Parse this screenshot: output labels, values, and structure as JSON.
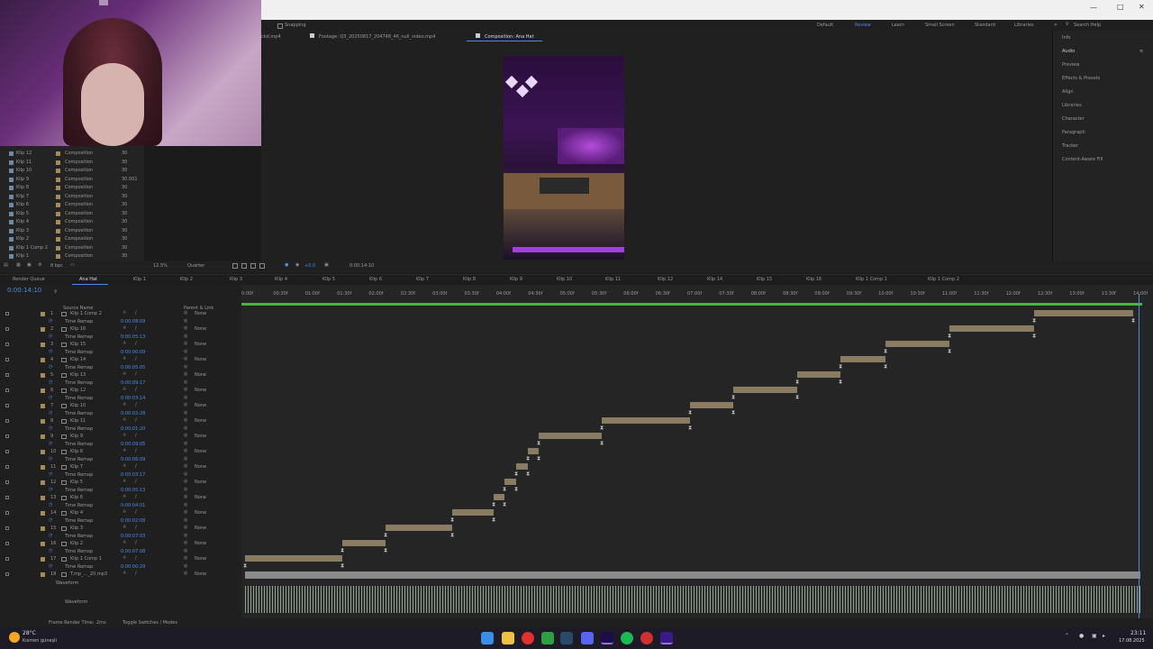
{
  "webcam": {
    "label": "webcam-overlay"
  },
  "header": {
    "snapping": "Snapping",
    "workspaces": [
      "Default",
      "Review",
      "Learn",
      "Small Screen",
      "Standard",
      "Libraries"
    ],
    "search_placeholder": "Search Help"
  },
  "viewer_tabs": {
    "tab1": "ckd.mp4",
    "tab2": "Footage: Q3_20250817_204748_46_null_video.mp4",
    "tab3": "Composition: Ana Hat"
  },
  "right_panel": {
    "items": [
      "Info",
      "Audio",
      "Preview",
      "Effects & Presets",
      "Align",
      "Libraries",
      "Character",
      "Paragraph",
      "Tracker",
      "Content-Aware Fill"
    ]
  },
  "project": {
    "rows": [
      {
        "name": "Klip 12",
        "type": "Composition",
        "fps": "30"
      },
      {
        "name": "Klip 11",
        "type": "Composition",
        "fps": "30"
      },
      {
        "name": "Klip 10",
        "type": "Composition",
        "fps": "30"
      },
      {
        "name": "Klip 9",
        "type": "Composition",
        "fps": "30.001"
      },
      {
        "name": "Klip 8",
        "type": "Composition",
        "fps": "30"
      },
      {
        "name": "Klip 7",
        "type": "Composition",
        "fps": "30"
      },
      {
        "name": "Klip 6",
        "type": "Composition",
        "fps": "30"
      },
      {
        "name": "Klip 5",
        "type": "Composition",
        "fps": "30"
      },
      {
        "name": "Klip 4",
        "type": "Composition",
        "fps": "30"
      },
      {
        "name": "Klip 3",
        "type": "Composition",
        "fps": "30"
      },
      {
        "name": "Klip 2",
        "type": "Composition",
        "fps": "30"
      },
      {
        "name": "Klip 1 Comp 2",
        "type": "Composition",
        "fps": "30"
      },
      {
        "name": "Klip 1",
        "type": "Composition",
        "fps": "30"
      }
    ],
    "bpc": "8 bpc"
  },
  "viewer_controls": {
    "zoom": "12.5%",
    "resolution": "Quarter",
    "timecode": "0:00:14:10",
    "plus": "+0.0"
  },
  "timeline_tabs": [
    "Render Queue",
    "Ana Hat",
    "Klip 1",
    "Klip 2",
    "Klip 3",
    "Klip 4",
    "Klip 5",
    "Klip 6",
    "Klip 7",
    "Klip 8",
    "Klip 9",
    "Klip 10",
    "Klip 11",
    "Klip 12",
    "Klip 14",
    "Klip 15",
    "Klip 16",
    "Klip 1 Comp 1",
    "Klip 1 Comp 2"
  ],
  "timeline": {
    "current_time": "0:00:14:10",
    "col_source": "Source Name",
    "col_parent": "Parent & Link",
    "ruler": [
      "0:00f",
      "00:30f",
      "01:00f",
      "01:30f",
      "02:00f",
      "02:30f",
      "03:00f",
      "03:30f",
      "04:00f",
      "04:30f",
      "05:00f",
      "05:30f",
      "06:00f",
      "06:30f",
      "07:00f",
      "07:30f",
      "08:00f",
      "08:30f",
      "09:00f",
      "09:30f",
      "10:00f",
      "10:30f",
      "11:00f",
      "11:30f",
      "12:00f",
      "12:30f",
      "13:00f",
      "13:30f",
      "14:00f"
    ],
    "layers": [
      {
        "num": "1",
        "name": "Klip 1 Comp 2",
        "remap": "0:00:08:09",
        "parent": "None"
      },
      {
        "num": "2",
        "name": "Klip 16",
        "remap": "0:00:05:13",
        "parent": "None"
      },
      {
        "num": "3",
        "name": "Klip 15",
        "remap": "0:00:00:09",
        "parent": "None"
      },
      {
        "num": "4",
        "name": "Klip 14",
        "remap": "0:00:05:05",
        "parent": "None"
      },
      {
        "num": "5",
        "name": "Klip 13",
        "remap": "0:00:09:17",
        "parent": "None"
      },
      {
        "num": "6",
        "name": "Klip 12",
        "remap": "0:00:03:14",
        "parent": "None"
      },
      {
        "num": "7",
        "name": "Klip 10",
        "remap": "0:00:03:28",
        "parent": "None"
      },
      {
        "num": "8",
        "name": "Klip 11",
        "remap": "0:00:01:20",
        "parent": "None"
      },
      {
        "num": "9",
        "name": "Klip 9",
        "remap": "0:00:09:05",
        "parent": "None"
      },
      {
        "num": "10",
        "name": "Klip 8",
        "remap": "0:00:06:09",
        "parent": "None"
      },
      {
        "num": "11",
        "name": "Klip 7",
        "remap": "0:00:03:17",
        "parent": "None"
      },
      {
        "num": "12",
        "name": "Klip 5",
        "remap": "0:00:05:13",
        "parent": "None"
      },
      {
        "num": "13",
        "name": "Klip 6",
        "remap": "0:00:04:01",
        "parent": "None"
      },
      {
        "num": "14",
        "name": "Klip 4",
        "remap": "0:00:02:08",
        "parent": "None"
      },
      {
        "num": "15",
        "name": "Klip 3",
        "remap": "0:00:07:03",
        "parent": "None"
      },
      {
        "num": "16",
        "name": "Klip 2",
        "remap": "0:00:07:08",
        "parent": "None"
      },
      {
        "num": "17",
        "name": "Klip 1 Comp 1",
        "remap": "0:00:00:29",
        "parent": "None"
      },
      {
        "num": "18",
        "name": "T.mp_..._20.mp3",
        "remap": "",
        "parent": "None"
      }
    ],
    "remap_label": "Time Remap",
    "waveform_label": "Waveform",
    "waveform_label2": "Waveform"
  },
  "status": {
    "render_time_label": "Frame Render Time:",
    "render_time_value": "2ms",
    "toggle": "Toggle Switches / Modes"
  },
  "taskbar": {
    "weather_temp": "28°C",
    "weather_desc": "Kısmen güneşli",
    "time": "23:11",
    "date": "17.08.2025"
  }
}
